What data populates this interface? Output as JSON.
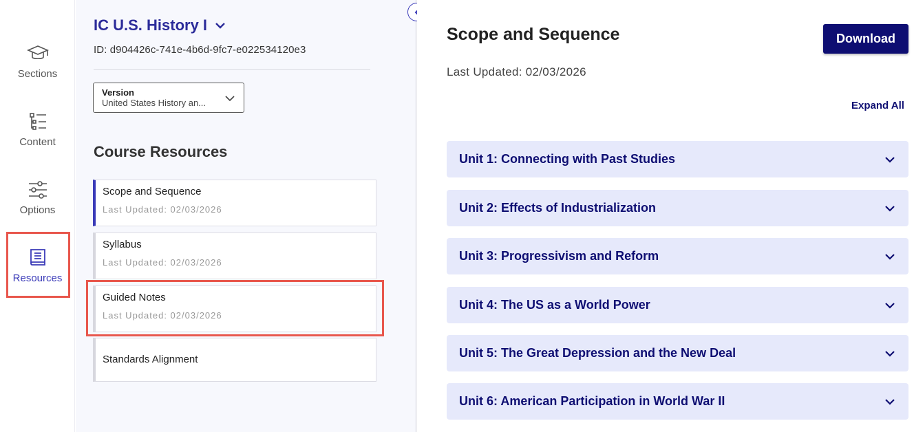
{
  "nav": {
    "items": [
      {
        "label": "Sections",
        "icon": "graduation-cap-icon"
      },
      {
        "label": "Content",
        "icon": "list-tree-icon"
      },
      {
        "label": "Options",
        "icon": "sliders-icon"
      },
      {
        "label": "Resources",
        "icon": "book-icon",
        "active": true
      }
    ]
  },
  "course": {
    "title": "IC U.S. History I",
    "id": "ID: d904426c-741e-4b6d-9fc7-e022534120e3",
    "version_label": "Version",
    "version_value": "United States History an..."
  },
  "resources": {
    "heading": "Course Resources",
    "items": [
      {
        "title": "Scope and Sequence",
        "date": "Last Updated: 02/03/2026"
      },
      {
        "title": "Syllabus",
        "date": "Last Updated: 02/03/2026"
      },
      {
        "title": "Guided Notes",
        "date": "Last Updated: 02/03/2026"
      },
      {
        "title": "Standards Alignment"
      }
    ]
  },
  "main": {
    "title": "Scope and Sequence",
    "updated": "Last Updated: 02/03/2026",
    "download_label": "Download",
    "expand_all_label": "Expand All",
    "units": [
      "Unit 1: Connecting with Past Studies",
      "Unit 2: Effects of Industrialization",
      "Unit 3: Progressivism and Reform",
      "Unit 4: The US as a World Power",
      "Unit 5: The Great Depression and the New Deal",
      "Unit 6: American Participation in World War II"
    ]
  },
  "colors": {
    "accent": "#3a3ab8",
    "dark_navy": "#0e0e72",
    "unit_bg": "#e6e9fb",
    "highlight": "#e8574d"
  }
}
